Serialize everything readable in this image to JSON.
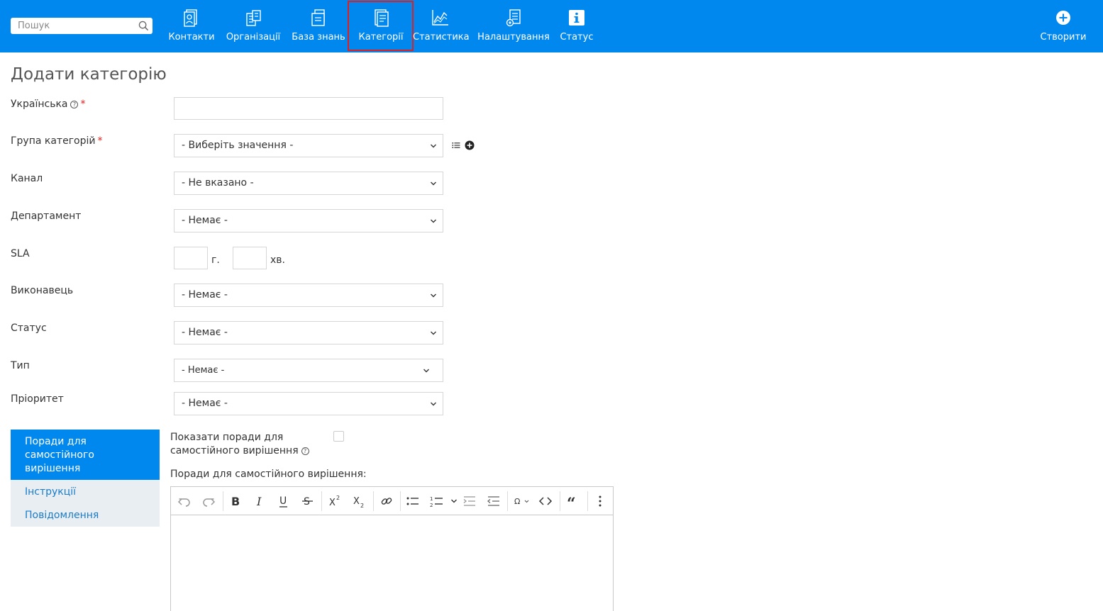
{
  "search": {
    "placeholder": "Пошук",
    "icon": "search-icon"
  },
  "nav": {
    "items": [
      {
        "label": "Контакти",
        "icon": "contacts-icon"
      },
      {
        "label": "Організації",
        "icon": "organizations-icon"
      },
      {
        "label": "База знань",
        "icon": "knowledge-base-icon"
      },
      {
        "label": "Категорії",
        "icon": "categories-icon",
        "active": true
      },
      {
        "label": "Статистика",
        "icon": "statistics-icon"
      },
      {
        "label": "Налаштування",
        "icon": "settings-icon"
      },
      {
        "label": "Статус",
        "icon": "info-icon"
      }
    ],
    "create_label": "Створити"
  },
  "colors": {
    "topbar": "#0088ee",
    "active_outline": "#e02020",
    "link": "#1a7cc8",
    "required": "#e02020"
  },
  "form": {
    "title": "Додати категорію",
    "ukrainian_label": "Українська",
    "group_label": "Група категорій",
    "group_value": "- Виберіть значення -",
    "channel_label": "Канал",
    "channel_value": "- Не вказано -",
    "department_label": "Департамент",
    "department_value": "- Немає -",
    "sla_label": "SLA",
    "sla_hours_unit": "г.",
    "sla_minutes_unit": "хв.",
    "assignee_label": "Виконавець",
    "assignee_value": "- Немає -",
    "status_label": "Статус",
    "status_value": "- Немає -",
    "type_label": "Тип",
    "type_value": "- Немає -",
    "priority_label": "Пріоритет",
    "priority_value": "- Немає -",
    "required_mark": "*",
    "help_mark": "?"
  },
  "tabs": {
    "active": "Поради для самостійного вирішення",
    "instructions": "Інструкції",
    "messages": "Повідомлення"
  },
  "tips": {
    "show_label_line1": "Показати поради для",
    "show_label_line2": "самостійного вирішення",
    "editor_label": "Поради для самостійного вирішення:"
  }
}
